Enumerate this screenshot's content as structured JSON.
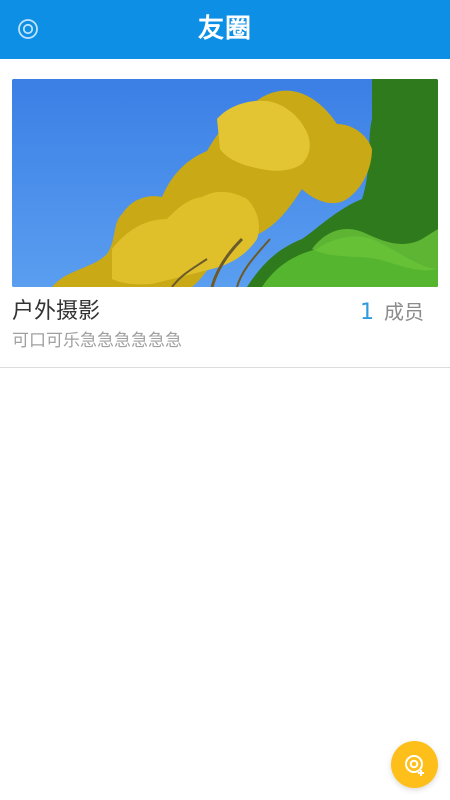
{
  "header": {
    "title": "友圈",
    "left_icon": "settings-ring-icon",
    "bar_color": "#0c8fe5"
  },
  "groups": [
    {
      "name": "户外摄影",
      "member_count": "1",
      "member_label": "成员",
      "description": "可口可乐急急急急急急",
      "cover_image": "tree-photo"
    }
  ],
  "fab": {
    "icon": "add-group-icon",
    "color": "#ffbf1a"
  }
}
